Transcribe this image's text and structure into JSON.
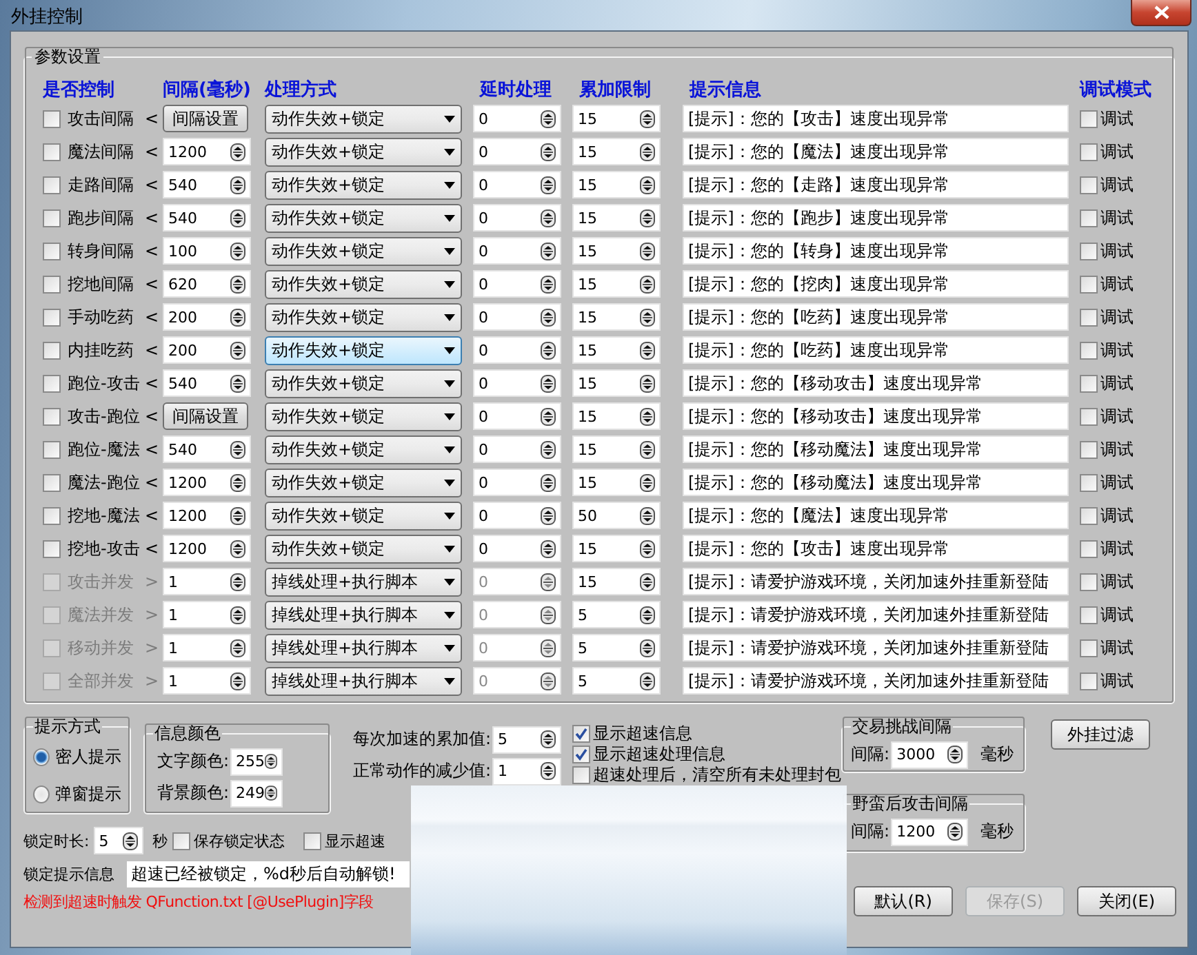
{
  "window": {
    "title": "外挂控制"
  },
  "params": {
    "title": "参数设置",
    "columns": [
      "是否控制",
      "间隔(毫秒)",
      "处理方式",
      "延时处理",
      "累加限制",
      "提示信息",
      "调试模式"
    ],
    "rows": [
      {
        "label": "攻击间隔",
        "arrow": "<",
        "enabled": true,
        "checked": false,
        "interval": {
          "kind": "button",
          "text": "间隔设置"
        },
        "method": "动作失效+锁定",
        "highlighted": false,
        "delay": "0",
        "limit": "15",
        "hint": "[提示]：您的【攻击】速度出现异常",
        "debug_label": "调试",
        "debug": false
      },
      {
        "label": "魔法间隔",
        "arrow": "<",
        "enabled": true,
        "checked": false,
        "interval": {
          "kind": "spin",
          "text": "1200"
        },
        "method": "动作失效+锁定",
        "highlighted": false,
        "delay": "0",
        "limit": "15",
        "hint": "[提示]：您的【魔法】速度出现异常",
        "debug_label": "调试",
        "debug": false
      },
      {
        "label": "走路间隔",
        "arrow": "<",
        "enabled": true,
        "checked": false,
        "interval": {
          "kind": "spin",
          "text": "540"
        },
        "method": "动作失效+锁定",
        "highlighted": false,
        "delay": "0",
        "limit": "15",
        "hint": "[提示]：您的【走路】速度出现异常",
        "debug_label": "调试",
        "debug": false
      },
      {
        "label": "跑步间隔",
        "arrow": "<",
        "enabled": true,
        "checked": false,
        "interval": {
          "kind": "spin",
          "text": "540"
        },
        "method": "动作失效+锁定",
        "highlighted": false,
        "delay": "0",
        "limit": "15",
        "hint": "[提示]：您的【跑步】速度出现异常",
        "debug_label": "调试",
        "debug": false
      },
      {
        "label": "转身间隔",
        "arrow": "<",
        "enabled": true,
        "checked": false,
        "interval": {
          "kind": "spin",
          "text": "100"
        },
        "method": "动作失效+锁定",
        "highlighted": false,
        "delay": "0",
        "limit": "15",
        "hint": "[提示]：您的【转身】速度出现异常",
        "debug_label": "调试",
        "debug": false
      },
      {
        "label": "挖地间隔",
        "arrow": "<",
        "enabled": true,
        "checked": false,
        "interval": {
          "kind": "spin",
          "text": "620"
        },
        "method": "动作失效+锁定",
        "highlighted": false,
        "delay": "0",
        "limit": "15",
        "hint": "[提示]：您的【挖肉】速度出现异常",
        "debug_label": "调试",
        "debug": false
      },
      {
        "label": "手动吃药",
        "arrow": "<",
        "enabled": true,
        "checked": false,
        "interval": {
          "kind": "spin",
          "text": "200"
        },
        "method": "动作失效+锁定",
        "highlighted": false,
        "delay": "0",
        "limit": "15",
        "hint": "[提示]：您的【吃药】速度出现异常",
        "debug_label": "调试",
        "debug": false
      },
      {
        "label": "内挂吃药",
        "arrow": "<",
        "enabled": true,
        "checked": false,
        "interval": {
          "kind": "spin",
          "text": "200"
        },
        "method": "动作失效+锁定",
        "highlighted": true,
        "delay": "0",
        "limit": "15",
        "hint": "[提示]：您的【吃药】速度出现异常",
        "debug_label": "调试",
        "debug": false
      },
      {
        "label": "跑位-攻击",
        "arrow": "<",
        "enabled": true,
        "checked": false,
        "interval": {
          "kind": "spin",
          "text": "540"
        },
        "method": "动作失效+锁定",
        "highlighted": false,
        "delay": "0",
        "limit": "15",
        "hint": "[提示]：您的【移动攻击】速度出现异常",
        "debug_label": "调试",
        "debug": false
      },
      {
        "label": "攻击-跑位",
        "arrow": "<",
        "enabled": true,
        "checked": false,
        "interval": {
          "kind": "button",
          "text": "间隔设置"
        },
        "method": "动作失效+锁定",
        "highlighted": false,
        "delay": "0",
        "limit": "15",
        "hint": "[提示]：您的【移动攻击】速度出现异常",
        "debug_label": "调试",
        "debug": false
      },
      {
        "label": "跑位-魔法",
        "arrow": "<",
        "enabled": true,
        "checked": false,
        "interval": {
          "kind": "spin",
          "text": "540"
        },
        "method": "动作失效+锁定",
        "highlighted": false,
        "delay": "0",
        "limit": "15",
        "hint": "[提示]：您的【移动魔法】速度出现异常",
        "debug_label": "调试",
        "debug": false
      },
      {
        "label": "魔法-跑位",
        "arrow": "<",
        "enabled": true,
        "checked": false,
        "interval": {
          "kind": "spin",
          "text": "1200"
        },
        "method": "动作失效+锁定",
        "highlighted": false,
        "delay": "0",
        "limit": "15",
        "hint": "[提示]：您的【移动魔法】速度出现异常",
        "debug_label": "调试",
        "debug": false
      },
      {
        "label": "挖地-魔法",
        "arrow": "<",
        "enabled": true,
        "checked": false,
        "interval": {
          "kind": "spin",
          "text": "1200"
        },
        "method": "动作失效+锁定",
        "highlighted": false,
        "delay": "0",
        "limit": "50",
        "hint": "[提示]：您的【魔法】速度出现异常",
        "debug_label": "调试",
        "debug": false
      },
      {
        "label": "挖地-攻击",
        "arrow": "<",
        "enabled": true,
        "checked": false,
        "interval": {
          "kind": "spin",
          "text": "1200"
        },
        "method": "动作失效+锁定",
        "highlighted": false,
        "delay": "0",
        "limit": "15",
        "hint": "[提示]：您的【攻击】速度出现异常",
        "debug_label": "调试",
        "debug": false
      },
      {
        "label": "攻击并发",
        "arrow": ">",
        "enabled": false,
        "checked": false,
        "interval": {
          "kind": "spin",
          "text": "1"
        },
        "method": "掉线处理+执行脚本",
        "highlighted": false,
        "delay": "0",
        "limit": "15",
        "hint": "[提示]：请爱护游戏环境，关闭加速外挂重新登陆",
        "debug_label": "调试",
        "debug": false
      },
      {
        "label": "魔法并发",
        "arrow": ">",
        "enabled": false,
        "checked": false,
        "interval": {
          "kind": "spin",
          "text": "1"
        },
        "method": "掉线处理+执行脚本",
        "highlighted": false,
        "delay": "0",
        "limit": "5",
        "hint": "[提示]：请爱护游戏环境，关闭加速外挂重新登陆",
        "debug_label": "调试",
        "debug": false
      },
      {
        "label": "移动并发",
        "arrow": ">",
        "enabled": false,
        "checked": false,
        "interval": {
          "kind": "spin",
          "text": "1"
        },
        "method": "掉线处理+执行脚本",
        "highlighted": false,
        "delay": "0",
        "limit": "5",
        "hint": "[提示]：请爱护游戏环境，关闭加速外挂重新登陆",
        "debug_label": "调试",
        "debug": false
      },
      {
        "label": "全部并发",
        "arrow": ">",
        "enabled": false,
        "checked": false,
        "interval": {
          "kind": "spin",
          "text": "1"
        },
        "method": "掉线处理+执行脚本",
        "highlighted": false,
        "delay": "0",
        "limit": "5",
        "hint": "[提示]：请爱护游戏环境，关闭加速外挂重新登陆",
        "debug_label": "调试",
        "debug": false
      }
    ]
  },
  "hint_mode": {
    "title": "提示方式",
    "options": [
      {
        "label": "密人提示",
        "selected": true
      },
      {
        "label": "弹窗提示",
        "selected": false
      }
    ]
  },
  "info_color": {
    "title": "信息颜色",
    "fields": [
      {
        "label": "文字颜色:",
        "value": "255"
      },
      {
        "label": "背景颜色:",
        "value": "249"
      }
    ]
  },
  "speed_fields": [
    {
      "label": "每次加速的累加值:",
      "value": "5"
    },
    {
      "label": "正常动作的减少值:",
      "value": "1"
    }
  ],
  "options": [
    {
      "label": "显示超速信息",
      "checked": true
    },
    {
      "label": "显示超速处理信息",
      "checked": true
    },
    {
      "label": "超速处理后，清空所有未处理封包",
      "checked": false
    }
  ],
  "intervals": [
    {
      "title": "交易挑战间隔",
      "label": "间隔:",
      "value": "3000",
      "unit": "毫秒"
    },
    {
      "title": "野蛮后攻击间隔",
      "label": "间隔:",
      "value": "1200",
      "unit": "毫秒"
    }
  ],
  "filter_button": "外挂过滤",
  "lock": {
    "label": "锁定时长:",
    "value": "5",
    "unit": "秒",
    "checks": [
      {
        "label": "保存锁定状态",
        "checked": false
      },
      {
        "label": "显示超速",
        "checked": false
      }
    ],
    "message_label": "锁定提示信息",
    "message": "超速已经被锁定，%d秒后自动解锁!"
  },
  "trigger_note": "检测到超速时触发 QFunction.txt [@UsePlugin]字段",
  "buttons": [
    {
      "label": "默认(R)",
      "disabled": false
    },
    {
      "label": "保存(S)",
      "disabled": true
    },
    {
      "label": "关闭(E)",
      "disabled": false
    }
  ]
}
